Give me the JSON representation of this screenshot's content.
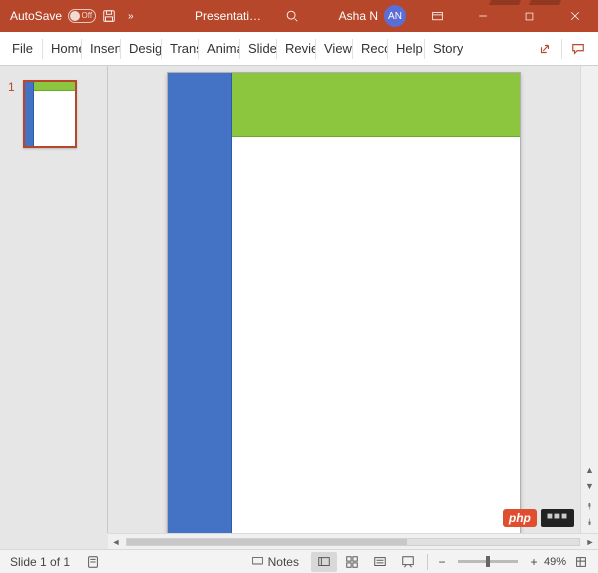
{
  "titlebar": {
    "autosave_label": "AutoSave",
    "autosave_state": "Off",
    "doc_title": "Presentati…",
    "user_name": "Asha N",
    "user_initials": "AN"
  },
  "ribbon": {
    "tabs": [
      "File",
      "Home",
      "Insert",
      "Design",
      "Trans",
      "Anima",
      "Slide",
      "Revie",
      "View",
      "Reco",
      "Help",
      "Storyl"
    ]
  },
  "thumb": {
    "slide_number": "1"
  },
  "status": {
    "slide_info": "Slide 1 of 1",
    "notes_label": "Notes",
    "zoom_pct": "49%"
  },
  "badges": {
    "php": "php",
    "cnt": "■■■"
  },
  "colors": {
    "accent": "#b7472a",
    "blue": "#4472c4",
    "green": "#8cc63f"
  }
}
